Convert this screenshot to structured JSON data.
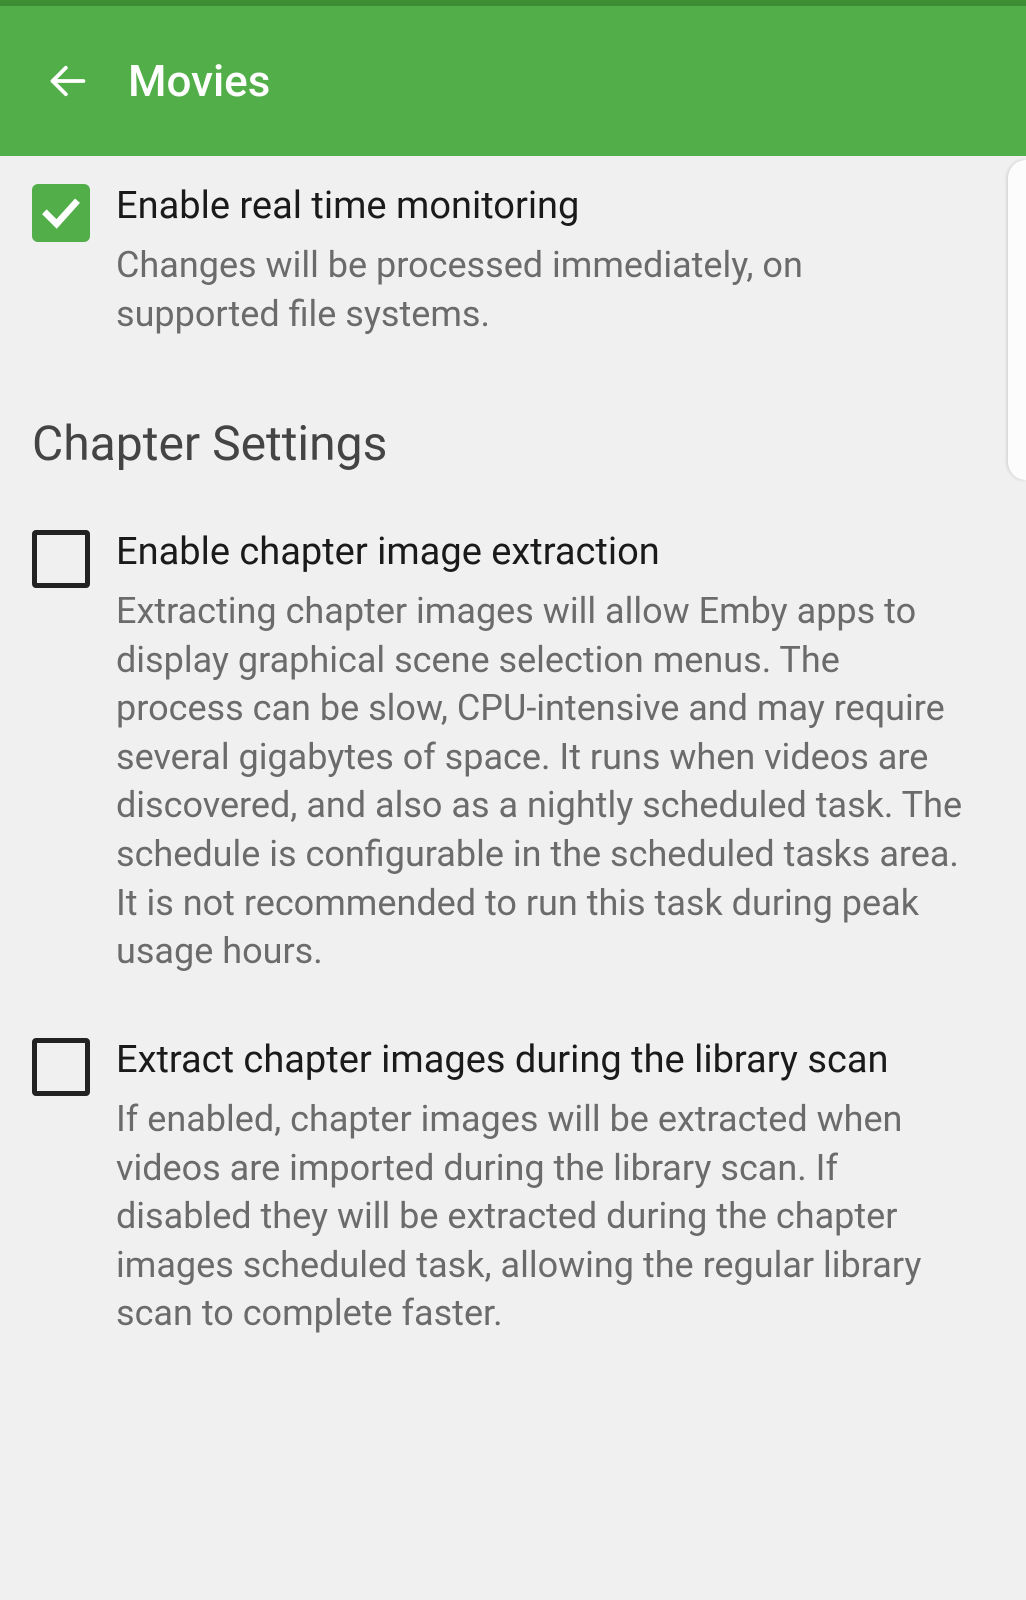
{
  "header": {
    "title": "Movies"
  },
  "settings": {
    "realtime": {
      "title": "Enable real time monitoring",
      "desc": "Changes will be processed immediately, on supported file systems.",
      "checked": true
    },
    "section_chapter": "Chapter Settings",
    "chapter_extract": {
      "title": "Enable chapter image extraction",
      "desc": "Extracting chapter images will allow Emby apps to display graphical scene selection menus. The process can be slow, CPU-intensive and may require several gigabytes of space. It runs when videos are discovered, and also as a nightly scheduled task. The schedule is configurable in the scheduled tasks area. It is not recommended to run this task during peak usage hours.",
      "checked": false
    },
    "chapter_scan": {
      "title": "Extract chapter images during the library scan",
      "desc": "If enabled, chapter images will be extracted when videos are imported during the library scan. If disabled they will be extracted during the chapter images scheduled task, allowing the regular library scan to complete faster.",
      "checked": false
    }
  }
}
